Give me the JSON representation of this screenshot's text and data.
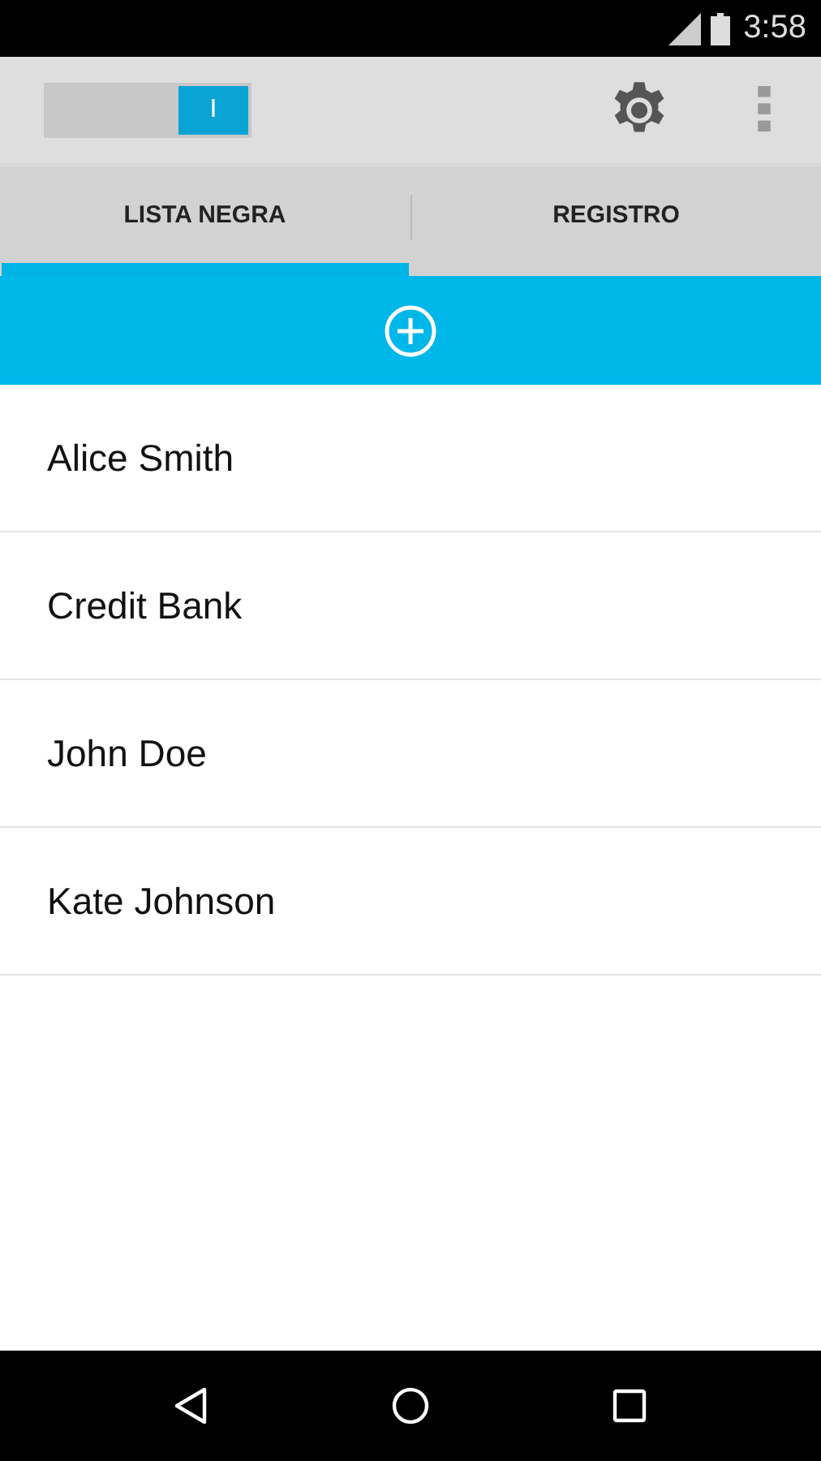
{
  "status_bar": {
    "time": "3:58"
  },
  "action_bar": {
    "switch": {
      "label": "I",
      "on": true
    }
  },
  "tabs": [
    {
      "label": "LISTA NEGRA",
      "selected": true
    },
    {
      "label": "REGISTRO",
      "selected": false
    }
  ],
  "contacts": [
    {
      "name": "Alice Smith"
    },
    {
      "name": "Credit Bank"
    },
    {
      "name": "John Doe"
    },
    {
      "name": "Kate Johnson"
    }
  ]
}
